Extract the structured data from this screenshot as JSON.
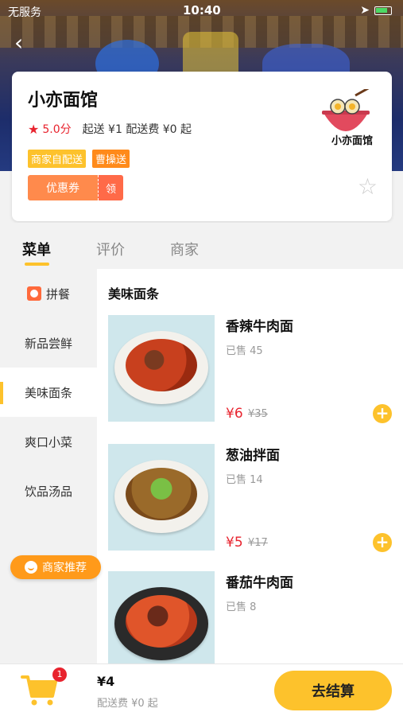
{
  "status_bar": {
    "carrier": "无服务",
    "time": "10:40"
  },
  "shop": {
    "name": "小亦面馆",
    "logo_text": "小亦面馆",
    "score": "5.0分",
    "delivery_info": "起送 ¥1 配送费 ¥0 起",
    "tags": [
      "商家自配送",
      "曹操送"
    ],
    "coupon_label": "优惠券",
    "coupon_action": "领"
  },
  "tabs": [
    "菜单",
    "评价",
    "商家"
  ],
  "categories": [
    "拼餐",
    "新品尝鲜",
    "美味面条",
    "爽口小菜",
    "饮品汤品"
  ],
  "recommend_label": "商家推荐",
  "section_title": "美味面条",
  "items": [
    {
      "name": "香辣牛肉面",
      "sold": "已售 45",
      "price": "¥6",
      "original_price": "¥35"
    },
    {
      "name": "葱油拌面",
      "sold": "已售 14",
      "price": "¥5",
      "original_price": "¥17"
    },
    {
      "name": "番茄牛肉面",
      "sold": "已售 8",
      "price": "",
      "original_price": ""
    }
  ],
  "cart": {
    "badge": "1",
    "total": "¥4",
    "fee_text": "配送费 ¥0 起",
    "checkout_label": "去结算"
  },
  "colors": {
    "accent": "#fdc22c",
    "price_red": "#e8232e",
    "coupon_orange": "#ff8a4c"
  }
}
